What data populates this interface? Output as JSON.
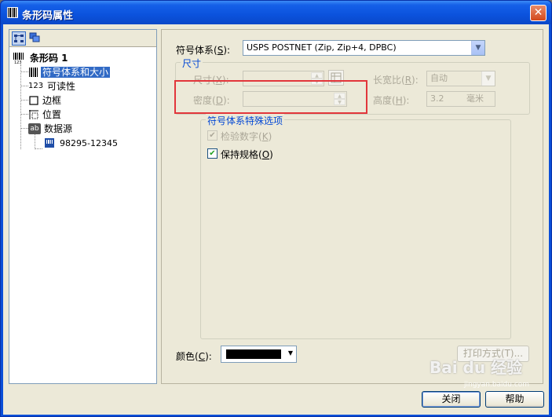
{
  "window": {
    "title": "条形码属性",
    "close_symbol": "✕"
  },
  "tree": {
    "toolbar_icons": [
      "tree-view-icon",
      "layers-icon"
    ],
    "items": [
      {
        "label": "条形码 1",
        "icon": "barcode-icon"
      },
      {
        "label": "符号体系和大小",
        "icon": "barcode-icon"
      },
      {
        "label": "可读性",
        "icon": "readability-icon",
        "icon_text": "123"
      },
      {
        "label": "边框",
        "icon": "border-icon"
      },
      {
        "label": "位置",
        "icon": "position-icon"
      },
      {
        "label": "数据源",
        "icon": "data-source-icon",
        "icon_text": "ab"
      },
      {
        "label": "98295-12345",
        "icon": "variable-icon"
      }
    ]
  },
  "symbology": {
    "label": "符号体系",
    "hotkey": "S",
    "value": "USPS POSTNET (Zip, Zip+4, DPBC)"
  },
  "size_group": {
    "title": "尺寸",
    "size_label": "尺寸",
    "size_hotkey": "X",
    "size_value": "",
    "density_label": "密度",
    "density_hotkey": "D",
    "density_value": "",
    "ratio_label": "长宽比",
    "ratio_hotkey": "R",
    "ratio_value": "自动",
    "height_label": "高度",
    "height_hotkey": "H",
    "height_value": "3.2",
    "height_unit": "毫米"
  },
  "special_options": {
    "title": "符号体系特殊选项",
    "check_digit_label": "检验数字",
    "check_digit_hotkey": "K",
    "check_digit_checked": true,
    "preserve_label": "保持规格",
    "preserve_hotkey": "O",
    "preserve_checked": true
  },
  "color": {
    "label": "颜色",
    "hotkey": "C",
    "value": "#000000"
  },
  "buttons": {
    "print_mode": "打印方式(T)...",
    "close": "关闭",
    "help": "帮助"
  },
  "watermark": {
    "text": "Bai du 经验",
    "sub": "jingyan.baidu.com"
  }
}
